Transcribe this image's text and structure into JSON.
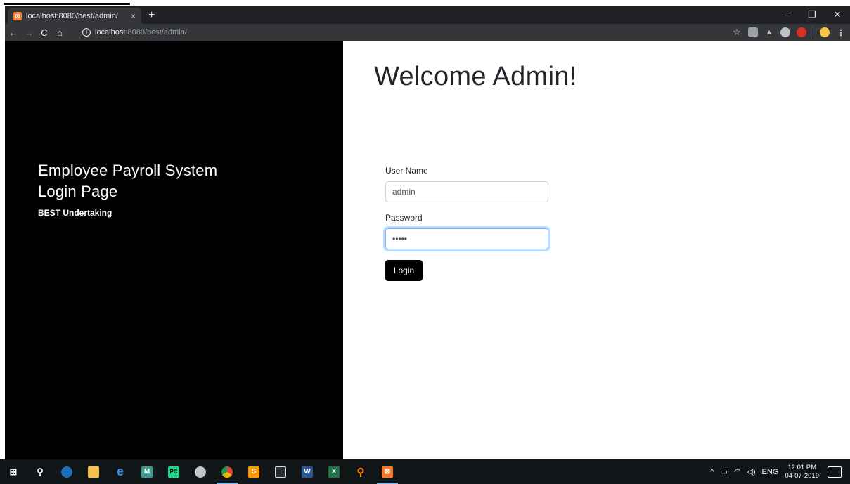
{
  "browser": {
    "tab_title": "localhost:8080/best/admin/",
    "tab_close": "×",
    "new_tab": "+",
    "url_host": "localhost",
    "url_rest": ":8080/best/admin/",
    "window_controls": {
      "minimize": "−",
      "maximize": "❐",
      "close": "✕"
    },
    "nav": {
      "back": "←",
      "forward": "→",
      "reload": "C",
      "home": "⌂"
    },
    "info_glyph": "i",
    "bookmark_star": "☆",
    "menu_glyph": "⋮"
  },
  "left_panel": {
    "line1": "Employee Payroll System",
    "line2": "Login Page",
    "subtitle": "BEST Undertaking"
  },
  "right_panel": {
    "heading": "Welcome Admin!",
    "username_label": "User Name",
    "username_value": "admin",
    "password_label": "Password",
    "password_value": "•••••",
    "login_label": "Login"
  },
  "taskbar": {
    "tray_arrow": "^",
    "language": "ENG",
    "time": "12:01 PM",
    "date": "04-07-2019"
  },
  "colors": {
    "left_panel_bg": "#000000",
    "login_button_bg": "#000000",
    "focus_ring": "#80bdff",
    "chrome_dark": "#202124"
  }
}
